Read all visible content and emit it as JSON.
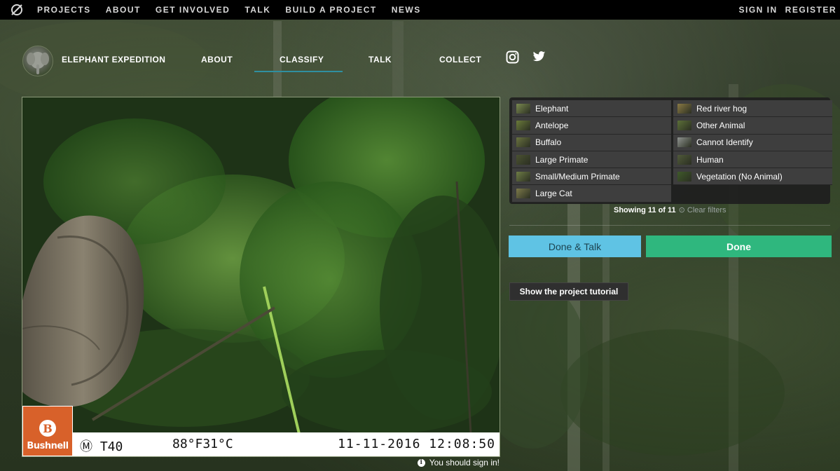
{
  "topbar": {
    "nav": [
      "PROJECTS",
      "ABOUT",
      "GET INVOLVED",
      "TALK",
      "BUILD A PROJECT",
      "NEWS"
    ],
    "sign_in": "SIGN IN",
    "register": "REGISTER"
  },
  "project": {
    "title": "ELEPHANT EXPEDITION",
    "nav": {
      "about": "ABOUT",
      "classify": "CLASSIFY",
      "talk": "TALK",
      "collect": "COLLECT"
    },
    "active_tab": "CLASSIFY",
    "social_icons": [
      "instagram-icon",
      "twitter-icon"
    ]
  },
  "subject": {
    "brand": "Bushnell",
    "camera_id": "Ⓜ T40",
    "temperature": "88°F31°C",
    "timestamp": "11-11-2016 12:08:50"
  },
  "signin_note": "You should sign in!",
  "choices": [
    {
      "label": "Elephant",
      "thumb_color": "#7b8a50"
    },
    {
      "label": "Red river hog",
      "thumb_color": "#8a7a44"
    },
    {
      "label": "Antelope",
      "thumb_color": "#6b7b3a"
    },
    {
      "label": "Other Animal",
      "thumb_color": "#5c7038"
    },
    {
      "label": "Buffalo",
      "thumb_color": "#6a7340"
    },
    {
      "label": "Cannot Identify",
      "thumb_color": "#8f9490"
    },
    {
      "label": "Large Primate",
      "thumb_color": "#4b5232"
    },
    {
      "label": "Human",
      "thumb_color": "#505a3a"
    },
    {
      "label": "Small/Medium Primate",
      "thumb_color": "#6f7d45"
    },
    {
      "label": "Vegetation (No Animal)",
      "thumb_color": "#3f5a2a"
    },
    {
      "label": "Large Cat",
      "thumb_color": "#7d7a4a"
    }
  ],
  "filter_status": {
    "showing": "Showing 11 of 11",
    "clear": "Clear filters"
  },
  "buttons": {
    "done_talk": "Done & Talk",
    "done": "Done",
    "tutorial": "Show the project tutorial"
  },
  "colors": {
    "done_talk": "#5fc3e4",
    "done": "#2fb77e",
    "active_underline": "#2f8fa0"
  }
}
